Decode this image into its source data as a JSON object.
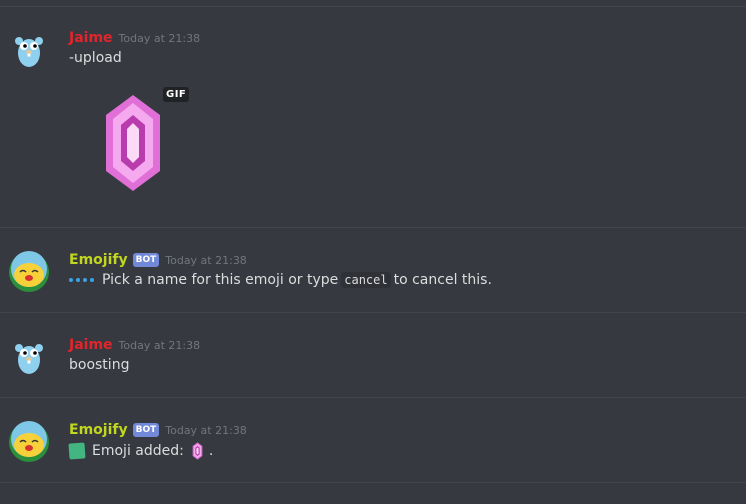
{
  "messages": [
    {
      "author": "Jaime",
      "time": "Today at 21:38",
      "text": "-upload",
      "badge": "GIF"
    },
    {
      "author": "Emojify",
      "bot": "BOT",
      "time": "Today at 21:38",
      "text_before": "Pick a name for this emoji or type",
      "code": "cancel",
      "text_after": "to cancel this."
    },
    {
      "author": "Jaime",
      "time": "Today at 21:38",
      "text": "boosting"
    },
    {
      "author": "Emojify",
      "bot": "BOT",
      "time": "Today at 21:38",
      "text": "Emoji added:",
      "trailing": "."
    }
  ],
  "colors": {
    "jaime": "#e3242b",
    "emojify": "#c1d61f",
    "bot_badge": "#7289da",
    "background": "#36393f"
  },
  "icons": [
    "gopher-avatar",
    "emojify-avatar",
    "pink-crystal-emoji",
    "loading-dots-icon",
    "green-square-icon"
  ]
}
